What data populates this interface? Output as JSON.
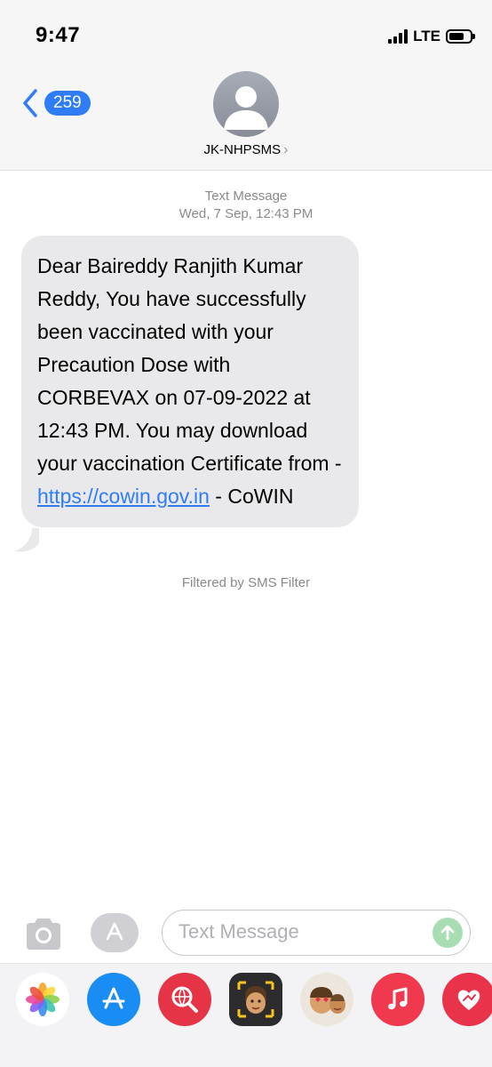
{
  "status_bar": {
    "time": "9:47",
    "network": "LTE"
  },
  "header": {
    "back_count": "259",
    "contact_name": "JK-NHPSMS",
    "chevron_glyph": "›"
  },
  "thread": {
    "message_type": "Text Message",
    "timestamp": "Wed, 7 Sep, 12:43 PM",
    "message": {
      "text_before_link": "Dear Baireddy Ranjith Kumar Reddy, You have successfully been vaccinated with your Precaution Dose with CORBEVAX on 07-09-2022 at 12:43 PM. You may download your vaccination Certificate from - ",
      "link_text": "https://cowin.gov.in",
      "text_after_link": " - CoWIN"
    },
    "filter_note": "Filtered by SMS Filter"
  },
  "compose": {
    "placeholder": "Text Message"
  },
  "app_drawer": {
    "apps": [
      {
        "name": "photos-icon"
      },
      {
        "name": "app-store-icon"
      },
      {
        "name": "web-images-icon"
      },
      {
        "name": "memoji-icon"
      },
      {
        "name": "memoji-stickers-icon"
      },
      {
        "name": "music-icon"
      },
      {
        "name": "digital-touch-icon"
      }
    ]
  },
  "colors": {
    "accent": "#2f7df6",
    "bubble": "#e9e9eb",
    "send": "#a8dcb3"
  }
}
